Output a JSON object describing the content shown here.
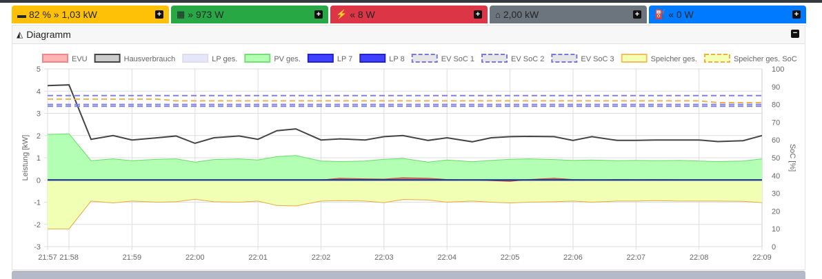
{
  "tiles": [
    {
      "icon": "battery-icon",
      "glyph": "▬",
      "text": "82 % » 1,03 kW",
      "bg": "#ffc107",
      "fg": "#212529"
    },
    {
      "icon": "solar-panel-icon",
      "glyph": "▦",
      "text": "» 973 W",
      "bg": "#28a745",
      "fg": "#212529"
    },
    {
      "icon": "power-grid-icon",
      "glyph": "⚡",
      "text": "« 8 W",
      "bg": "#dc3545",
      "fg": "#212529"
    },
    {
      "icon": "home-icon",
      "glyph": "⌂",
      "text": "2,00 kW",
      "bg": "#6c757d",
      "fg": "#212529"
    },
    {
      "icon": "charging-station-icon",
      "glyph": "⛽",
      "text": "« 0 W",
      "bg": "#007bff",
      "fg": "#212529"
    }
  ],
  "card": {
    "title": "Diagramm"
  },
  "chart_data": {
    "type": "line",
    "ylabel": "Leistung [kW]",
    "y2label": "SoC [%]",
    "ylim": [
      -3,
      5
    ],
    "y2lim": [
      0,
      100
    ],
    "yticks": [
      "5",
      "4",
      "3",
      "2",
      "1",
      "0",
      "-1",
      "-2",
      "-3"
    ],
    "y2ticks": [
      "100",
      "90",
      "80",
      "70",
      "60",
      "50",
      "40",
      "30",
      "20",
      "10",
      "0"
    ],
    "xlim": [
      -0.34,
      11
    ],
    "xticks": [
      {
        "label": "21:57",
        "x": -0.34
      },
      {
        "label": "21:58",
        "x": 0
      },
      {
        "label": "21:59",
        "x": 1
      },
      {
        "label": "22:00",
        "x": 2
      },
      {
        "label": "22:01",
        "x": 3
      },
      {
        "label": "22:02",
        "x": 4
      },
      {
        "label": "22:03",
        "x": 5
      },
      {
        "label": "22:04",
        "x": 6
      },
      {
        "label": "22:05",
        "x": 7
      },
      {
        "label": "22:06",
        "x": 8
      },
      {
        "label": "22:07",
        "x": 9
      },
      {
        "label": "22:08",
        "x": 10
      },
      {
        "label": "22:09",
        "x": 11
      }
    ],
    "x": [
      -0.34,
      0,
      0.35,
      0.7,
      1.0,
      1.4,
      1.7,
      2.0,
      2.3,
      2.7,
      3.0,
      3.3,
      3.6,
      4.0,
      4.3,
      4.7,
      5.0,
      5.3,
      5.7,
      6.0,
      6.4,
      6.7,
      7.0,
      7.3,
      7.7,
      8.0,
      8.3,
      8.7,
      9.0,
      9.3,
      9.7,
      10.0,
      10.3,
      10.7,
      11.0
    ],
    "legend": [
      {
        "name": "EVU",
        "fill": "#ffb3b3",
        "stroke": "#e88",
        "dash": false
      },
      {
        "name": "Hausverbrauch",
        "fill": "#ccc",
        "stroke": "#444",
        "dash": false
      },
      {
        "name": "LP ges.",
        "fill": "#e6e6fa",
        "stroke": "#dde",
        "dash": false
      },
      {
        "name": "PV ges.",
        "fill": "#b3ffb3",
        "stroke": "#7d7",
        "dash": false
      },
      {
        "name": "LP 7",
        "fill": "#4040ff",
        "stroke": "#2222cc",
        "dash": false
      },
      {
        "name": "LP 8",
        "fill": "#4040ff",
        "stroke": "#2222cc",
        "dash": false
      },
      {
        "name": "EV SoC 1",
        "fill": "#e6e6e6",
        "stroke": "#77d",
        "dash": true
      },
      {
        "name": "EV SoC 2",
        "fill": "#e6e6e6",
        "stroke": "#77d",
        "dash": true
      },
      {
        "name": "EV SoC 3",
        "fill": "#e6e6e6",
        "stroke": "#77d",
        "dash": true
      },
      {
        "name": "Speicher ges.",
        "fill": "#f5ffb3",
        "stroke": "#f0c060",
        "dash": false
      },
      {
        "name": "Speicher ges. SoC",
        "fill": "#f5ffb3",
        "stroke": "#f0b040",
        "dash": true
      }
    ],
    "series": [
      {
        "name": "PV ges.",
        "axis": "kW",
        "kind": "area",
        "fill": "#b3ffb3",
        "stroke": "#6d6",
        "values": [
          2.05,
          2.08,
          0.87,
          0.95,
          0.87,
          0.93,
          0.95,
          0.8,
          0.92,
          0.95,
          0.9,
          1.05,
          1.1,
          0.85,
          0.83,
          0.85,
          0.93,
          0.97,
          0.8,
          0.9,
          0.82,
          0.88,
          0.93,
          0.95,
          0.92,
          0.88,
          0.9,
          0.87,
          0.88,
          0.87,
          0.88,
          0.85,
          0.83,
          0.85,
          0.95
        ]
      },
      {
        "name": "Speicher ges.",
        "axis": "kW",
        "kind": "area",
        "fill": "#f0ffb3",
        "stroke": "#e8a840",
        "values": [
          -2.2,
          -2.2,
          -0.95,
          -1.03,
          -0.95,
          -1.0,
          -0.98,
          -0.87,
          -0.98,
          -1.0,
          -0.95,
          -1.15,
          -1.17,
          -0.95,
          -0.93,
          -0.95,
          -1.02,
          -0.88,
          -0.9,
          -1.0,
          -0.95,
          -1.0,
          -1.03,
          -1.0,
          -0.98,
          -0.95,
          -1.0,
          -0.95,
          -0.95,
          -0.93,
          -0.95,
          -0.95,
          -0.95,
          -0.96,
          -1.02
        ]
      },
      {
        "name": "EVU",
        "axis": "kW",
        "kind": "area",
        "fill": "#d08070",
        "stroke": "#c04040",
        "values": [
          0,
          0,
          0,
          0,
          0,
          0,
          0,
          0,
          0,
          0,
          0,
          0,
          0,
          0,
          0.08,
          0.05,
          0.04,
          0.1,
          0.08,
          0.02,
          0,
          -0.03,
          -0.06,
          0.02,
          0.08,
          0.02,
          0,
          0.02,
          0.01,
          0.02,
          0.01,
          0.01,
          0.01,
          0.01,
          0.01
        ]
      },
      {
        "name": "LP 7",
        "axis": "kW",
        "kind": "line",
        "stroke": "#2222cc",
        "values": [
          0,
          0,
          0,
          0,
          0,
          0,
          0,
          0,
          0,
          0,
          0,
          0,
          0,
          0,
          0,
          0,
          0,
          0,
          0,
          0,
          0,
          0,
          0,
          0,
          0,
          0,
          0,
          0,
          0,
          0,
          0,
          0,
          0,
          0,
          0
        ]
      },
      {
        "name": "LP 8",
        "axis": "kW",
        "kind": "line",
        "stroke": "#1a3a8a",
        "values": [
          0,
          0,
          0,
          0,
          0,
          0,
          0,
          0,
          0,
          0,
          0,
          0,
          0,
          0,
          0,
          0,
          0,
          0,
          0,
          0,
          0,
          0,
          0,
          0,
          0,
          0,
          0,
          0,
          0,
          0,
          0,
          0,
          0,
          0,
          0
        ]
      },
      {
        "name": "Hausverbrauch",
        "axis": "kW",
        "kind": "line",
        "stroke": "#444",
        "values": [
          4.25,
          4.28,
          1.83,
          2.0,
          1.8,
          1.9,
          1.98,
          1.65,
          1.9,
          1.98,
          1.83,
          2.22,
          2.3,
          1.8,
          1.85,
          1.8,
          1.95,
          2.0,
          1.78,
          1.9,
          1.72,
          1.9,
          1.95,
          1.96,
          1.95,
          1.78,
          1.95,
          1.78,
          1.78,
          1.8,
          1.8,
          1.8,
          1.73,
          1.77,
          2.0
        ]
      },
      {
        "name": "EV SoC 1",
        "axis": "soc",
        "kind": "dash",
        "stroke": "#8080e0",
        "values": [
          85,
          85,
          85,
          85,
          85,
          85,
          85,
          85,
          85,
          85,
          85,
          85,
          85,
          85,
          85,
          85,
          85,
          85,
          85,
          85,
          85,
          85,
          85,
          85,
          85,
          85,
          85,
          85,
          85,
          85,
          85,
          85,
          85,
          85,
          85
        ]
      },
      {
        "name": "EV SoC 2",
        "axis": "soc",
        "kind": "dash",
        "stroke": "#8080e0",
        "values": [
          80,
          80,
          80,
          80,
          80,
          80,
          80,
          80,
          80,
          80,
          80,
          80,
          80,
          80,
          80,
          80,
          80,
          80,
          80,
          80,
          80,
          80,
          80,
          80,
          80,
          80,
          80,
          80,
          80,
          80,
          80,
          80,
          80,
          80,
          80
        ]
      },
      {
        "name": "EV SoC 3",
        "axis": "soc",
        "kind": "dash",
        "stroke": "#8080e0",
        "values": [
          79,
          79,
          79,
          79,
          79,
          79,
          79,
          79,
          79,
          79,
          79,
          79,
          79,
          79,
          79,
          79,
          79,
          79,
          79,
          79,
          79,
          79,
          79,
          79,
          79,
          79,
          79,
          79,
          79,
          79,
          79,
          79,
          79,
          79,
          79
        ]
      },
      {
        "name": "Speicher ges. SoC",
        "axis": "soc",
        "kind": "dash",
        "stroke": "#f0b050",
        "values": [
          83,
          83,
          83,
          83,
          83,
          83,
          82,
          82,
          82,
          82,
          82,
          82,
          82,
          82,
          82,
          82,
          82,
          82,
          82,
          82,
          82,
          82,
          82,
          82,
          82,
          82,
          82,
          82,
          82,
          82,
          82,
          82,
          81,
          81,
          81
        ]
      }
    ]
  }
}
